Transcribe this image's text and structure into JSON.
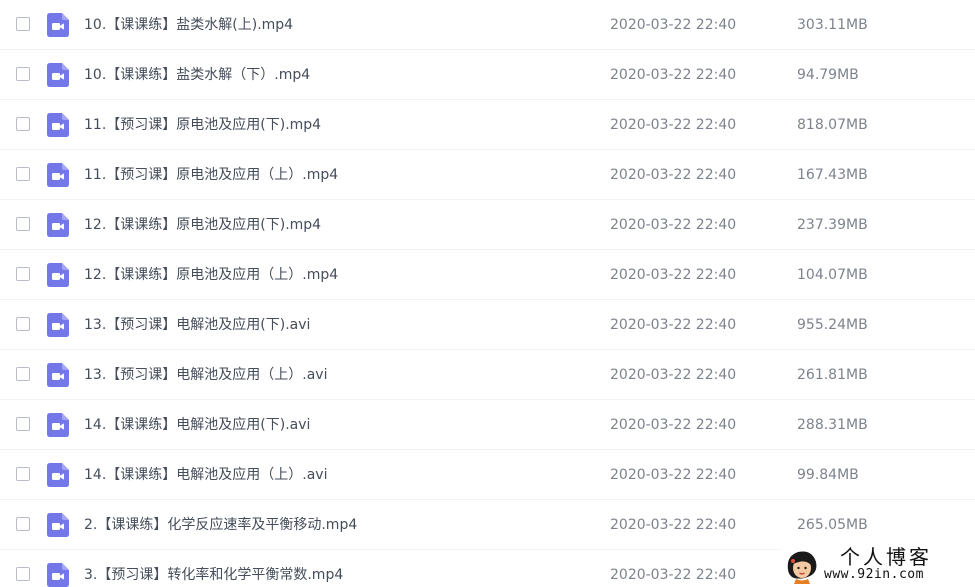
{
  "colors": {
    "video_icon": "#7477e8",
    "name_text": "#454d5a",
    "meta_text": "#7d838d",
    "checkbox_border": "#b8bdc7"
  },
  "file_icon": "video-file-icon",
  "files": [
    {
      "name": "10.【课课练】盐类水解(上).mp4",
      "date": "2020-03-22 22:40",
      "size": "303.11MB"
    },
    {
      "name": "10.【课课练】盐类水解（下）.mp4",
      "date": "2020-03-22 22:40",
      "size": "94.79MB"
    },
    {
      "name": "11.【预习课】原电池及应用(下).mp4",
      "date": "2020-03-22 22:40",
      "size": "818.07MB"
    },
    {
      "name": "11.【预习课】原电池及应用（上）.mp4",
      "date": "2020-03-22 22:40",
      "size": "167.43MB"
    },
    {
      "name": "12.【课课练】原电池及应用(下).mp4",
      "date": "2020-03-22 22:40",
      "size": "237.39MB"
    },
    {
      "name": "12.【课课练】原电池及应用（上）.mp4",
      "date": "2020-03-22 22:40",
      "size": "104.07MB"
    },
    {
      "name": "13.【预习课】电解池及应用(下).avi",
      "date": "2020-03-22 22:40",
      "size": "955.24MB"
    },
    {
      "name": "13.【预习课】电解池及应用（上）.avi",
      "date": "2020-03-22 22:40",
      "size": "261.81MB"
    },
    {
      "name": "14.【课课练】电解池及应用(下).avi",
      "date": "2020-03-22 22:40",
      "size": "288.31MB"
    },
    {
      "name": "14.【课课练】电解池及应用（上）.avi",
      "date": "2020-03-22 22:40",
      "size": "99.84MB"
    },
    {
      "name": "2.【课课练】化学反应速率及平衡移动.mp4",
      "date": "2020-03-22 22:40",
      "size": "265.05MB"
    },
    {
      "name": "3.【预习课】转化率和化学平衡常数.mp4",
      "date": "2020-03-22 22:40",
      "size": ""
    }
  ],
  "watermark": {
    "title": "个人博客",
    "url": "www.92in.com"
  }
}
